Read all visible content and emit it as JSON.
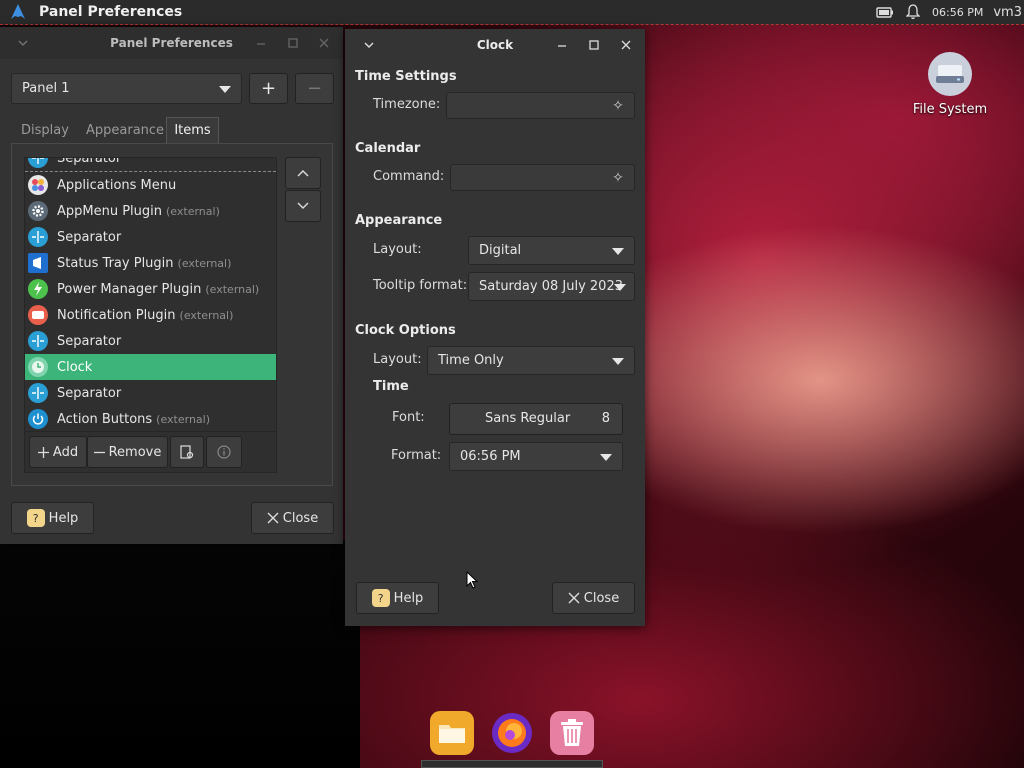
{
  "topbar": {
    "title": "Panel Preferences",
    "clock": "06:56 PM",
    "user": "vm3"
  },
  "desktop": {
    "icons": [
      {
        "label": "File System",
        "icon": "drive-icon"
      }
    ]
  },
  "panel_prefs": {
    "title": "Panel Preferences",
    "panel_select": "Panel 1",
    "add_btn": "+",
    "remove_btn": "−",
    "tabs": [
      "Display",
      "Appearance",
      "Items"
    ],
    "active_tab": "Items",
    "items": [
      {
        "label": "Separator",
        "ext": "",
        "icon": "separator-icon",
        "color": "#2a9fd6"
      },
      {
        "label": "Applications Menu",
        "ext": "",
        "icon": "apps-menu-icon",
        "color": "#e8e8e8"
      },
      {
        "label": "AppMenu Plugin",
        "ext": "(external)",
        "icon": "gear-icon",
        "color": "#5c6a78"
      },
      {
        "label": "Separator",
        "ext": "",
        "icon": "separator-icon",
        "color": "#2a9fd6"
      },
      {
        "label": "Status Tray Plugin",
        "ext": "(external)",
        "icon": "status-tray-icon",
        "color": "#1e6fd0"
      },
      {
        "label": "Power Manager Plugin",
        "ext": "(external)",
        "icon": "power-manager-icon",
        "color": "#4cc24c"
      },
      {
        "label": "Notification Plugin",
        "ext": "(external)",
        "icon": "notification-icon",
        "color": "#e8604c"
      },
      {
        "label": "Separator",
        "ext": "",
        "icon": "separator-icon",
        "color": "#2a9fd6"
      },
      {
        "label": "Clock",
        "ext": "",
        "icon": "clock-icon",
        "color": "#7fd3ad",
        "selected": true
      },
      {
        "label": "Separator",
        "ext": "",
        "icon": "separator-icon",
        "color": "#2a9fd6"
      },
      {
        "label": "Action Buttons",
        "ext": "(external)",
        "icon": "power-icon",
        "color": "#1e90d0"
      }
    ],
    "list_toolbar": {
      "add": "Add",
      "remove": "Remove"
    },
    "help": "Help",
    "close": "Close"
  },
  "clock_dialog": {
    "title": "Clock",
    "time_settings": {
      "heading": "Time Settings",
      "timezone_label": "Timezone:",
      "timezone_value": ""
    },
    "calendar": {
      "heading": "Calendar",
      "command_label": "Command:",
      "command_value": ""
    },
    "appearance": {
      "heading": "Appearance",
      "layout_label": "Layout:",
      "layout_value": "Digital",
      "tooltip_label": "Tooltip format:",
      "tooltip_value": "Saturday 08 July 2023"
    },
    "clock_options": {
      "heading": "Clock Options",
      "layout_label": "Layout:",
      "layout_value": "Time Only",
      "time_heading": "Time",
      "font_label": "Font:",
      "font_name": "Sans Regular",
      "font_size": "8",
      "format_label": "Format:",
      "format_value": "06:56 PM"
    },
    "help": "Help",
    "close": "Close"
  },
  "colors": {
    "accent": "#3db47a",
    "panel_bg": "#2b2b2b",
    "window_bg": "#333333"
  }
}
